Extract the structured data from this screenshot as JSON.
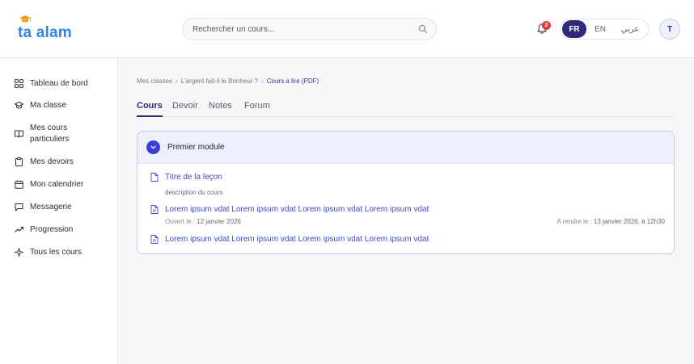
{
  "app": {
    "logo_text": "ta alam"
  },
  "header": {
    "search_placeholder": "Rechercher un cours...",
    "notifications_count": "2",
    "languages": [
      "FR",
      "EN",
      "عربي"
    ],
    "active_language": "FR",
    "avatar_initial": "T"
  },
  "sidebar": {
    "items": [
      {
        "label": "Tableau de bord",
        "icon": "dashboard-icon"
      },
      {
        "label": "Ma classe",
        "icon": "graduation-cap-icon"
      },
      {
        "label": "Mes cours particuliers",
        "icon": "book-open-icon"
      },
      {
        "label": "Mes devoirs",
        "icon": "clipboard-icon"
      },
      {
        "label": "Mon calendrier",
        "icon": "calendar-icon"
      },
      {
        "label": "Messagerie",
        "icon": "message-icon"
      },
      {
        "label": "Progression",
        "icon": "trending-up-icon"
      },
      {
        "label": "Tous les cours",
        "icon": "sparkle-icon"
      }
    ]
  },
  "breadcrumb": {
    "items": [
      "Mes classes",
      "L'argent fait-il le Bonheur ?",
      "Cours a lire (PDF)"
    ],
    "separator": "›"
  },
  "tabs": [
    "Cours",
    "Devoir",
    "Notes",
    "Forum"
  ],
  "active_tab": "Cours",
  "module": {
    "title": "Premier module",
    "lessons": [
      {
        "title": "Titre de la leçon",
        "description": "description du cours"
      },
      {
        "title": "Lorem ipsum vdat Lorem ipsum vdat Lorem ipsum vdat Lorem ipsum vdat",
        "opened_label": "Ouvert le :",
        "opened_date": "12 janvier 2026",
        "due_label": "A rendre le :",
        "due_date": "13 janvier 2026, à 12h30"
      },
      {
        "title": "Lorem ipsum vdat Lorem ipsum vdat Lorem ipsum vdat Lorem ipsum vdat"
      }
    ]
  },
  "colors": {
    "brand": "#2e86e6",
    "primary": "#2f2a7a",
    "link": "#4149c7",
    "accent": "#3b3fd8",
    "badge": "#e53935"
  }
}
